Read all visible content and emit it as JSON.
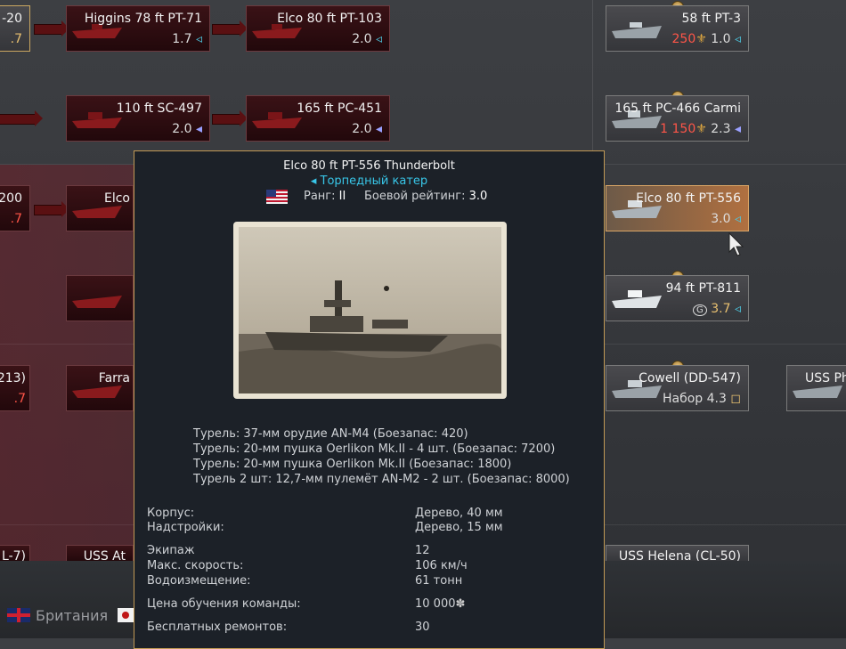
{
  "top_cards": [
    {
      "name": "-20",
      "br": ".7"
    },
    {
      "name": "Higgins 78 ft PT-71",
      "br": "1.7"
    },
    {
      "name": "Elco 80 ft PT-103",
      "br": "2.0"
    },
    {
      "name": "58 ft PT-3",
      "cost": "250",
      "br": "1.0"
    }
  ],
  "row2_cards": [
    {
      "name": "110 ft SC-497",
      "br": "2.0"
    },
    {
      "name": "165 ft PC-451",
      "br": "2.0"
    },
    {
      "name": "165 ft PC-466 Carmi",
      "cost": "1 150",
      "br": "2.3"
    }
  ],
  "row3_cards": [
    {
      "name": "-200",
      "br": ".7"
    },
    {
      "name": "Elco",
      "br": ""
    },
    {
      "name": "Elco 80 ft PT-556",
      "br": "3.0"
    }
  ],
  "row4_cards": [
    {
      "name": "94 ft PT-811",
      "br": "3.7"
    }
  ],
  "row5_cards": [
    {
      "name": "213)",
      "br": ".7"
    },
    {
      "name": "Farra",
      "br": ""
    },
    {
      "name": "Cowell (DD-547)",
      "br": "Набор 4.3"
    },
    {
      "name": "USS Ph",
      "br": ""
    }
  ],
  "row6_cards": [
    {
      "name": "L-7)"
    },
    {
      "name": "USS At"
    },
    {
      "name": "USS Helena (CL-50)"
    }
  ],
  "tooltip": {
    "title": "Elco 80 ft PT-556 Thunderbolt",
    "class": "◂ Торпедный катер",
    "rank_label": "Ранг:",
    "rank": "II",
    "rating_label": "Боевой рейтинг:",
    "rating": "3.0",
    "turrets": [
      "Турель: 37-мм орудие AN-M4 (Боезапас: 420)",
      "Турель: 20-мм пушка Oerlikon Mk.II - 4 шт. (Боезапас: 7200)",
      "Турель: 20-мм пушка Oerlikon Mk.II (Боезапас: 1800)",
      "Турель 2 шт: 12,7-мм пулемёт AN-M2 - 2 шт. (Боезапас: 8000)"
    ],
    "stats": [
      {
        "label": "Корпус:",
        "value": "Дерево, 40 мм"
      },
      {
        "label": "Надстройки:",
        "value": "Дерево, 15 мм"
      },
      {
        "label": "Экипаж",
        "value": "12"
      },
      {
        "label": "Макс. скорость:",
        "value": "106 км/ч"
      },
      {
        "label": "Водоизмещение:",
        "value": "61 тонн"
      },
      {
        "label": "Цена обучения команды:",
        "value": "10 000"
      },
      {
        "label": "Бесплатных ремонтов:",
        "value": "30"
      }
    ]
  },
  "nations": [
    "Британия"
  ]
}
